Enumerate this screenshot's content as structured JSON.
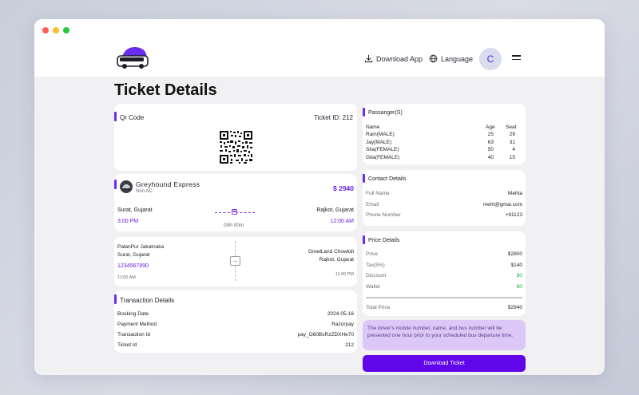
{
  "nav": {
    "download_app": "Download App",
    "language": "Language",
    "avatar_initial": "C"
  },
  "page": {
    "title": "Ticket Details"
  },
  "qr_card": {
    "title": "Qr Code",
    "ticket_id": "Ticket ID: 212"
  },
  "bus_card": {
    "operator": "Greyhound Express",
    "bus_type": "Non AC",
    "price": "$ 2940",
    "from_city": "Surat, Gujarat",
    "to_city": "Rajkot, Gujarat",
    "depart_time": "3:00 PM",
    "arrive_time": "12:00 AM",
    "duration": "09h 00m"
  },
  "stops_card": {
    "pickup_name": "PalanPur Jakatnaka",
    "pickup_city": "Surat, Gujarat",
    "pickup_phone": "1234567890",
    "pickup_time": "11:00 AM",
    "drop_name": "GreelLand Chowkdi",
    "drop_city": "Rajkot, Gujarat",
    "drop_time": "11:00 PM"
  },
  "transaction": {
    "title": "Transaction Details",
    "rows": [
      {
        "label": "Booking Date",
        "value": "2024-05-16"
      },
      {
        "label": "Payment Method",
        "value": "Razorpay"
      },
      {
        "label": "Transaction Id",
        "value": "pay_O80BsRzZDXHe70"
      },
      {
        "label": "Ticket Id",
        "value": "212"
      }
    ]
  },
  "passengers": {
    "title": "Passanger(S)",
    "headers": {
      "name": "Name",
      "age": "Age",
      "seat": "Seat"
    },
    "rows": [
      {
        "name": "Ram(MALE)",
        "age": "25",
        "seat": "29"
      },
      {
        "name": "Jay(MALE)",
        "age": "63",
        "seat": "31"
      },
      {
        "name": "Sita(FEMALE)",
        "age": "50",
        "seat": "4"
      },
      {
        "name": "Gita(FEMALE)",
        "age": "40",
        "seat": "15"
      }
    ]
  },
  "contact": {
    "title": "Contact Details",
    "rows": [
      {
        "label": "Full Name",
        "value": "Mehta"
      },
      {
        "label": "Email",
        "value": "meht@gmai.com"
      },
      {
        "label": "Phone Number",
        "value": "+91123"
      }
    ]
  },
  "price": {
    "title": "Price Details",
    "rows": [
      {
        "label": "Price",
        "value": "$2800"
      },
      {
        "label": "Tax(5%)",
        "value": "$140"
      },
      {
        "label": "Discount",
        "value": "$0"
      },
      {
        "label": "Wallet",
        "value": "$0"
      }
    ],
    "total_label": "Total Price",
    "total_value": "$2940"
  },
  "notice": "The driver's mobile number, name, and bus number will be presented one hour prior to your scheduled bus departure time.",
  "download_ticket": "Download Ticket",
  "colors": {
    "accent": "#6106e8",
    "green": "#16b34a",
    "notice_bg": "#dcc8f6"
  }
}
